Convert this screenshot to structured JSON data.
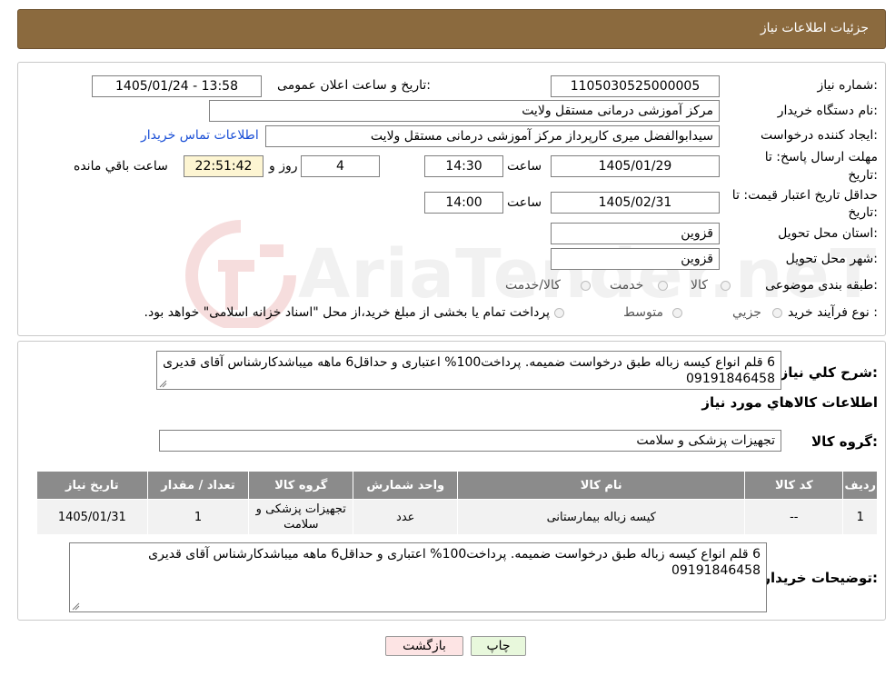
{
  "header": {
    "title": "جزئیات اطلاعات نیاز"
  },
  "info": {
    "need_number_label": "شماره نیاز:",
    "need_number": "1105030525000005",
    "announce_label": "تاریخ و ساعت اعلان عمومی:",
    "announce_value": "1405/01/24 - 13:58",
    "buyer_org_label": "نام دستگاه خریدار:",
    "buyer_org": "مرکز آموزشی درمانی مستقل ولایت",
    "creator_label": "ایجاد کننده درخواست:",
    "creator": "سیدابوالفضل میری کارپرداز مرکز آموزشی درمانی مستقل ولایت",
    "contact_link": "اطلاعات تماس خریدار",
    "reply_deadline_label_1": "مهلت ارسال پاسخ: تا",
    "reply_deadline_label_2": "تاریخ:",
    "reply_date": "1405/01/29",
    "time_label": "ساعت",
    "reply_time": "14:30",
    "days_value": "4",
    "days_label": "روز و",
    "remaining_time": "22:51:42",
    "remaining_label": "ساعت باقي مانده",
    "price_validity_label_1": "حداقل تاریخ اعتبار قیمت: تا",
    "price_validity_label_2": "تاریخ:",
    "price_validity_date": "1405/02/31",
    "price_validity_time": "14:00",
    "province_label": "استان محل تحویل:",
    "province": "قزوین",
    "city_label": "شهر محل تحویل:",
    "city": "قزوین",
    "category_label": "طبقه بندی موضوعی:",
    "category_options": [
      "کالا",
      "خدمت",
      "کالا/خدمت"
    ],
    "process_label": "نوع فرآیند خرید :",
    "process_options": [
      "جزيي",
      "متوسط"
    ],
    "process_note": "پرداخت تمام یا بخشی از مبلغ خرید،از محل \"اسناد خزانه اسلامی\" خواهد بود."
  },
  "summary": {
    "label": "شرح کلي نياز:",
    "text": "6 قلم انواع کیسه زباله طبق درخواست ضمیمه. پرداخت100% اعتباری و حداقل6 ماهه میباشدکارشناس آقای قدیری 09191846458"
  },
  "goods": {
    "section_title": "اطلاعات کالاهاي مورد نياز",
    "group_label": "گروه کالا:",
    "group_value": "تجهیزات پزشکی و سلامت",
    "columns": [
      "رديف",
      "کد کالا",
      "نام کالا",
      "واحد شمارش",
      "گروه کالا",
      "تعداد / مقدار",
      "تاريخ نياز"
    ],
    "rows": [
      [
        "1",
        "--",
        "کیسه زباله بیمارستانی",
        "عدد",
        "تجهیزات پزشکی و سلامت",
        "1",
        "1405/01/31"
      ]
    ]
  },
  "buyer_notes": {
    "label": "توضيحات خريدار:",
    "text": "6 قلم انواع کیسه زباله طبق درخواست ضمیمه. پرداخت100% اعتباری و حداقل6 ماهه میباشدکارشناس آقای قدیری 09191846458"
  },
  "watermark": {
    "text": "AriaTender.neT"
  },
  "buttons": {
    "print": "چاپ",
    "back": "بازگشت"
  },
  "colors": {
    "header_bg": "#8b6a3e",
    "table_header": "#8b8b8b",
    "link": "#1a4fd6",
    "print_btn": "#e8f8dc",
    "back_btn": "#fde4e4"
  }
}
